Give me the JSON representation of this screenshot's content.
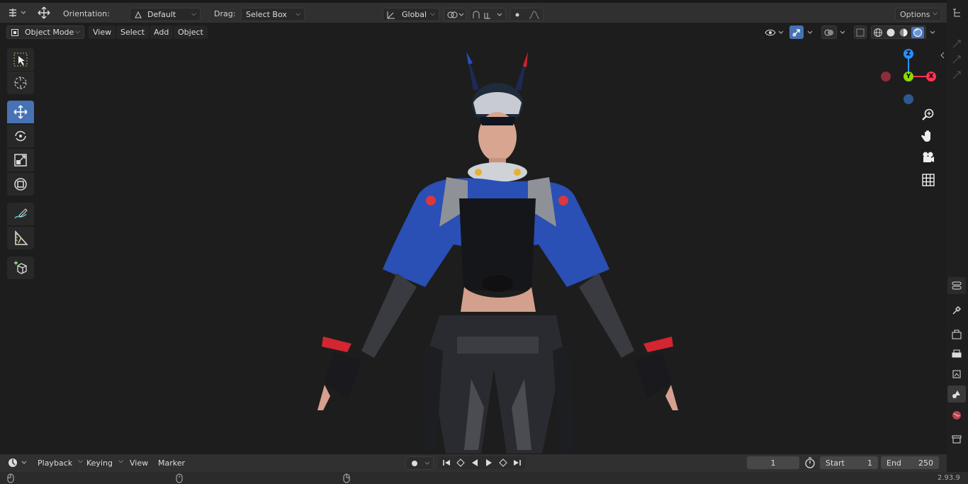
{
  "toolbar": {
    "orientation_label": "Orientation:",
    "orientation_value": "Default",
    "drag_label": "Drag:",
    "drag_value": "Select Box",
    "transform_space": "Global",
    "options_label": "Options"
  },
  "header": {
    "mode": "Object Mode",
    "menus": [
      "View",
      "Select",
      "Add",
      "Object"
    ]
  },
  "gizmo": {
    "z": "Z",
    "y": "Y",
    "x": "X"
  },
  "timeline": {
    "menus": [
      "Playback",
      "Keying",
      "View",
      "Marker"
    ],
    "current_frame": "1",
    "start_label": "Start",
    "start_value": "1",
    "end_label": "End",
    "end_value": "250"
  },
  "status": {
    "version": "2.93.9"
  },
  "colors": {
    "accent": "#4772b3",
    "axis_x": "#ff3352",
    "axis_y": "#8bdc00",
    "axis_z": "#2890ff"
  }
}
